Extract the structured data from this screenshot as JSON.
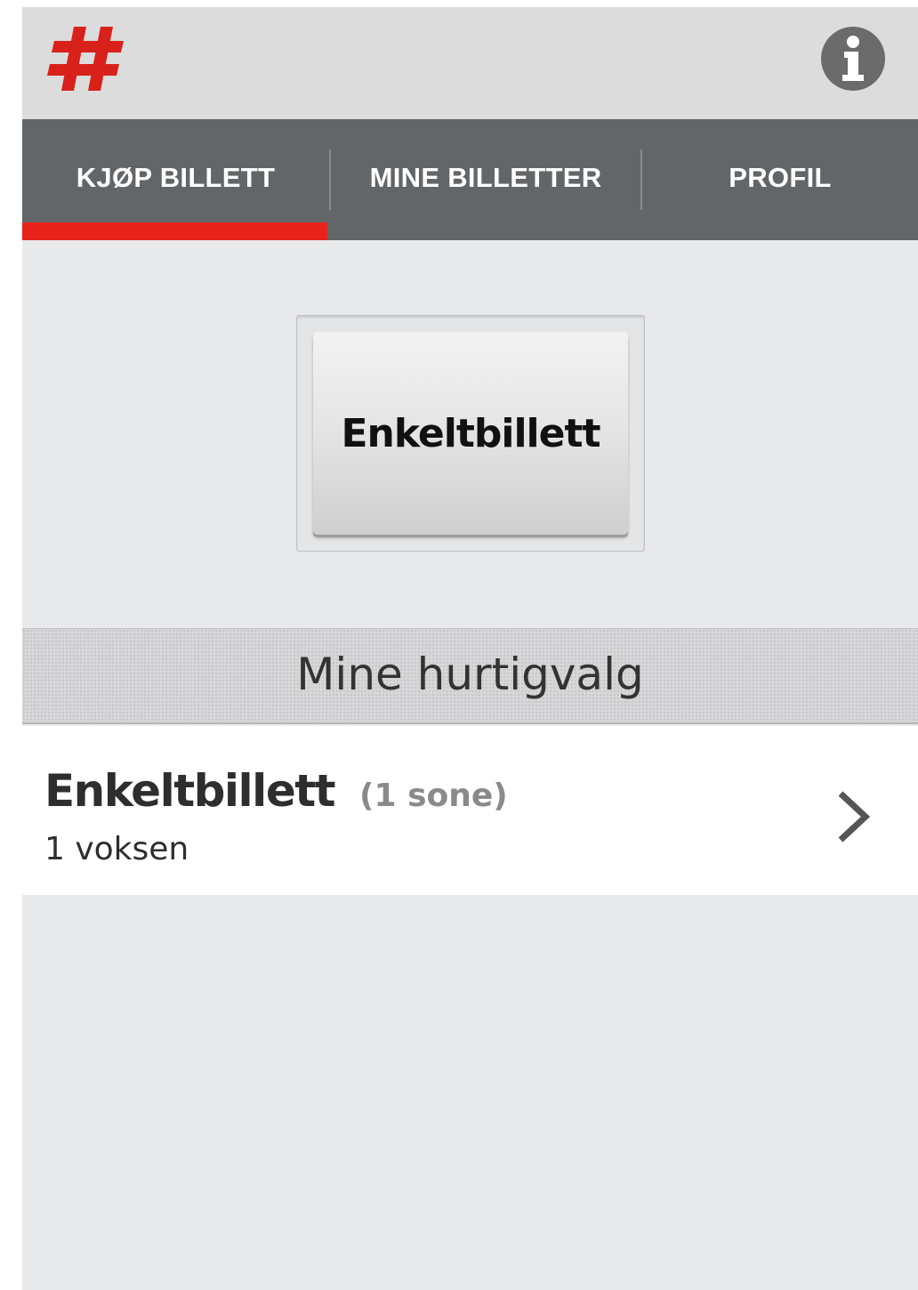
{
  "app": {
    "logo_icon": "hashtag-logo-icon",
    "logo_color": "#d8211a",
    "info_icon": "info-icon"
  },
  "tabs": [
    {
      "label": "KJØP BILLETT",
      "active": true
    },
    {
      "label": "MINE BILLETTER",
      "active": false
    },
    {
      "label": "PROFIL",
      "active": false
    }
  ],
  "accent_color": "#e8231c",
  "main": {
    "ticket_button_label": "Enkeltbillett"
  },
  "quick_choices": {
    "header": "Mine hurtigvalg",
    "items": [
      {
        "title": "Enkeltbillett",
        "zone": "(1 sone)",
        "passengers": "1 voksen",
        "chevron_icon": "chevron-right-icon"
      }
    ]
  }
}
